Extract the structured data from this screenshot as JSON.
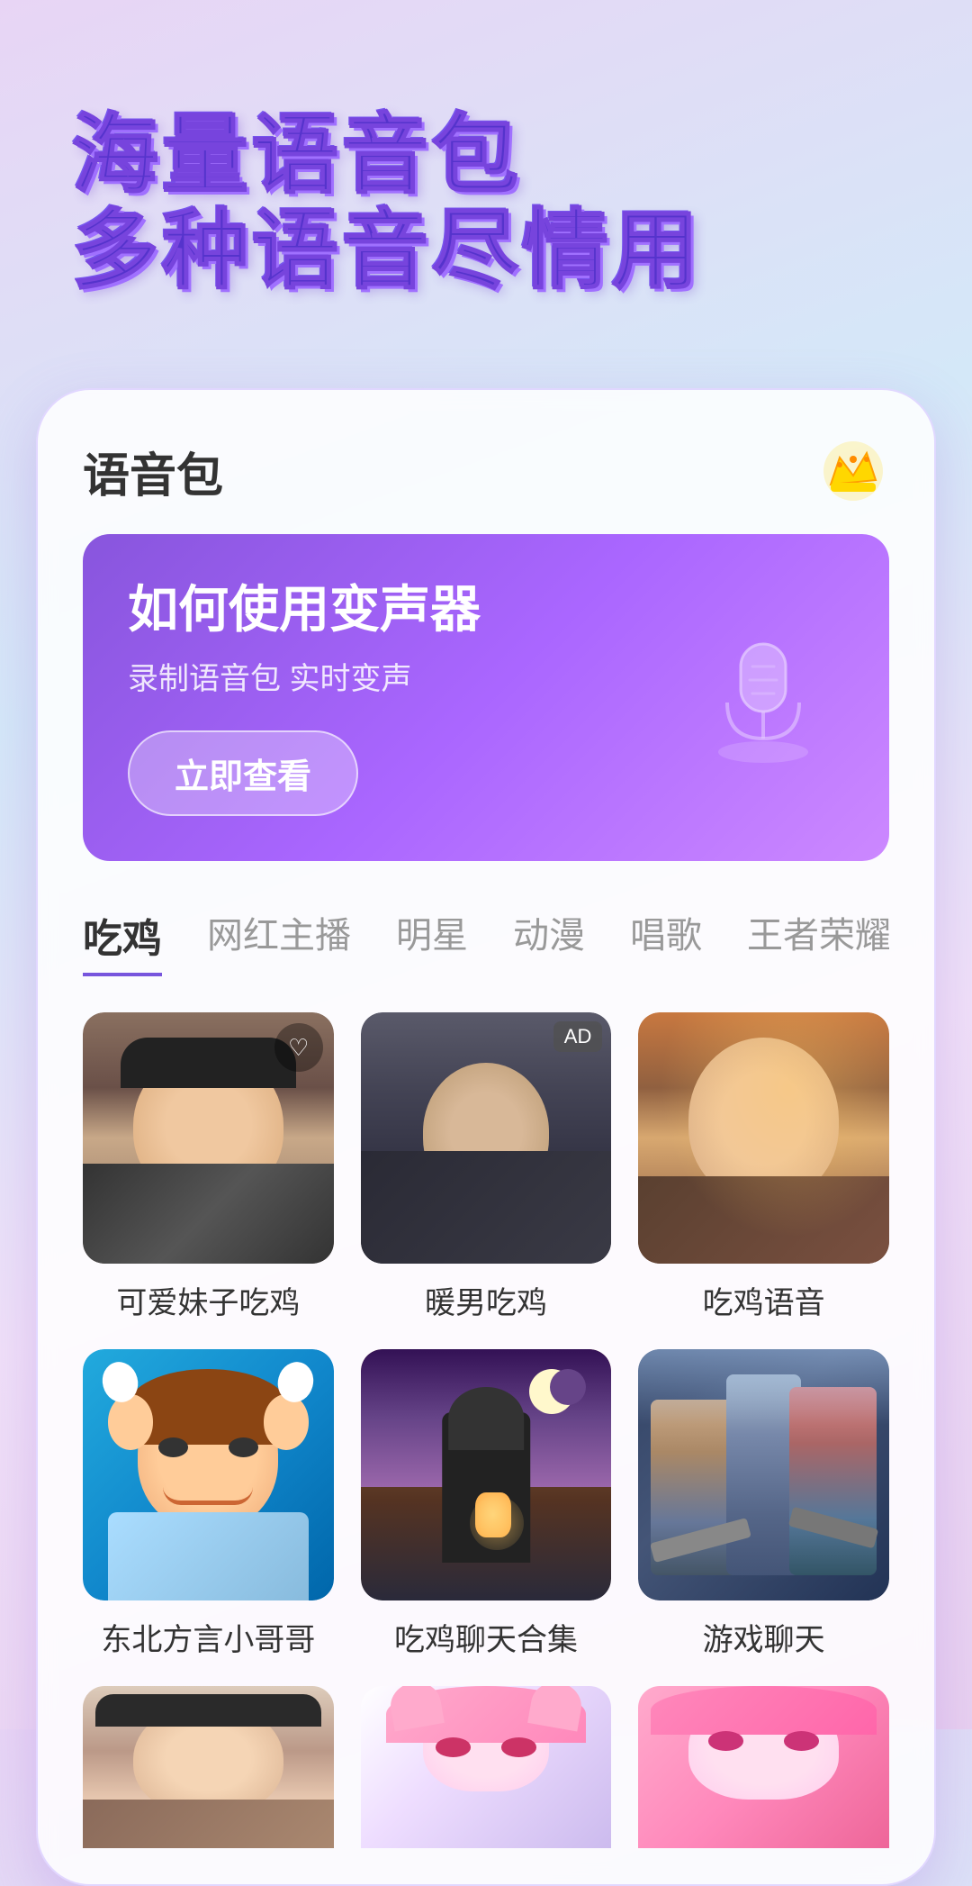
{
  "hero": {
    "line1": "海量语音包",
    "line2": "多种语音尽情用"
  },
  "card": {
    "title": "语音包",
    "crown_icon": "👑",
    "banner": {
      "title": "如何使用变声器",
      "subtitle": "录制语音包 实时变声",
      "button_label": "立即查看"
    },
    "tabs": [
      {
        "label": "吃鸡",
        "active": true
      },
      {
        "label": "网红主播",
        "active": false
      },
      {
        "label": "明星",
        "active": false
      },
      {
        "label": "动漫",
        "active": false
      },
      {
        "label": "唱歌",
        "active": false
      },
      {
        "label": "王者荣耀",
        "active": false
      }
    ],
    "grid_items": [
      {
        "label": "可爱妹子吃鸡",
        "thumb_class": "thumb-girl"
      },
      {
        "label": "暖男吃鸡",
        "thumb_class": "thumb-boy"
      },
      {
        "label": "吃鸡语音",
        "thumb_class": "thumb-woman"
      },
      {
        "label": "东北方言小哥哥",
        "thumb_class": "thumb-cartoon"
      },
      {
        "label": "吃鸡聊天合集",
        "thumb_class": "thumb-soldier"
      },
      {
        "label": "游戏聊天",
        "thumb_class": "thumb-gamechars"
      }
    ]
  }
}
